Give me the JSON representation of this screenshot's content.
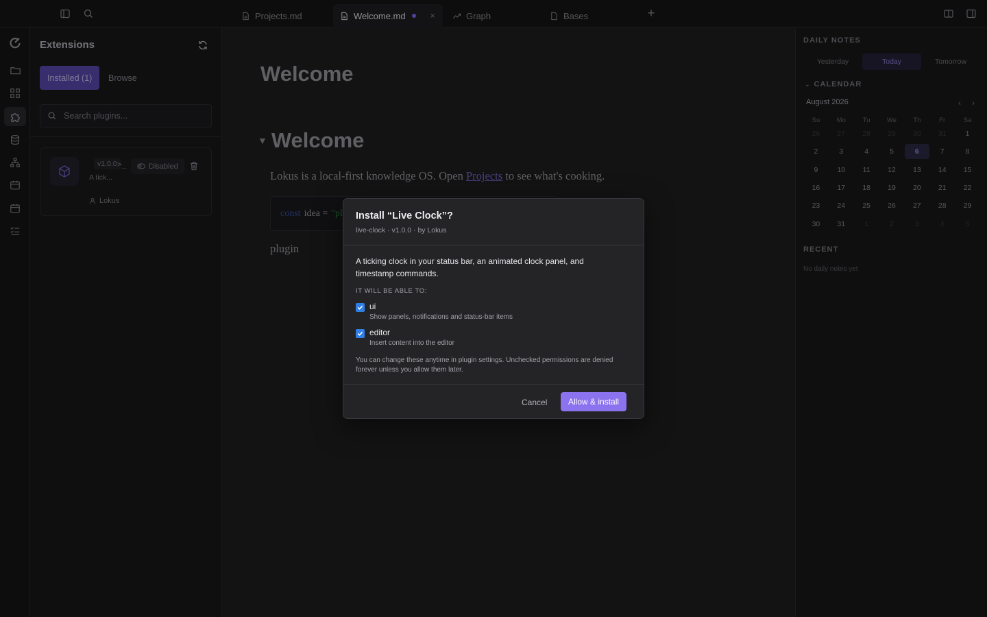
{
  "topbar": {
    "tabs": [
      {
        "label": "Projects.md",
        "icon": "file-icon"
      },
      {
        "label": "Welcome.md",
        "icon": "file-icon",
        "active": true,
        "unsaved": true
      },
      {
        "label": "Graph",
        "icon": "graph-icon"
      },
      {
        "label": "Bases",
        "icon": "file-icon"
      }
    ],
    "new_tab_label": "+",
    "close_label": "×"
  },
  "rail": {
    "items": [
      "logo-icon",
      "folder-icon",
      "grid-icon",
      "puzzle-icon",
      "database-icon",
      "sitemap-icon",
      "calendar-icon",
      "calendar-alt-icon",
      "checklist-icon"
    ],
    "active": "puzzle-icon"
  },
  "extensions": {
    "title": "Extensions",
    "tab_installed": "Installed (1)",
    "tab_browse": "Browse",
    "search_placeholder": "Search plugins...",
    "plugin": {
      "version": "v1.0.0",
      "terminal": ">_",
      "status": "Disabled",
      "description": "A tick...",
      "author": "Lokus"
    }
  },
  "editor": {
    "title": "Welcome",
    "heading": "Welcome",
    "para_before": "Lokus is a local-first knowledge OS. Open ",
    "para_link": "Projects",
    "para_after": " to see what's cooking.",
    "code_kw": "const",
    "code_id": "idea =",
    "code_str": "\"pl",
    "plugin_text": "plugin"
  },
  "daily_notes": {
    "heading": "DAILY NOTES",
    "tabs": [
      "Yesterday",
      "Today",
      "Tomorrow"
    ],
    "active_tab": "Today",
    "calendar_heading": "CALENDAR",
    "month": "August 2026",
    "prev": "‹",
    "next": "›",
    "weekdays": [
      "Su",
      "Mo",
      "Tu",
      "We",
      "Th",
      "Fr",
      "Sa"
    ],
    "weeks": [
      [
        "26",
        "27",
        "28",
        "29",
        "30",
        "31",
        "1"
      ],
      [
        "2",
        "3",
        "4",
        "5",
        "6",
        "7",
        "8"
      ],
      [
        "9",
        "10",
        "11",
        "12",
        "13",
        "14",
        "15"
      ],
      [
        "16",
        "17",
        "18",
        "19",
        "20",
        "21",
        "22"
      ],
      [
        "23",
        "24",
        "25",
        "26",
        "27",
        "28",
        "29"
      ],
      [
        "30",
        "31",
        "1",
        "2",
        "3",
        "4",
        "5"
      ]
    ],
    "today": "6",
    "recent_heading": "RECENT",
    "recent_empty": "No daily notes yet"
  },
  "modal": {
    "title": "Install “Live Clock”?",
    "subtitle": "live-clock · v1.0.0 · by Lokus",
    "description": "A ticking clock in your status bar, an animated clock panel, and timestamp commands.",
    "able_heading": "IT WILL BE ABLE TO:",
    "permissions": [
      {
        "name": "ui",
        "desc": "Show panels, notifications and status-bar items",
        "checked": true
      },
      {
        "name": "editor",
        "desc": "Insert content into the editor",
        "checked": true
      }
    ],
    "note": "You can change these anytime in plugin settings. Unchecked permissions are denied forever unless you allow them later.",
    "cancel": "Cancel",
    "confirm": "Allow & install",
    "accent": "#8b72ee"
  }
}
